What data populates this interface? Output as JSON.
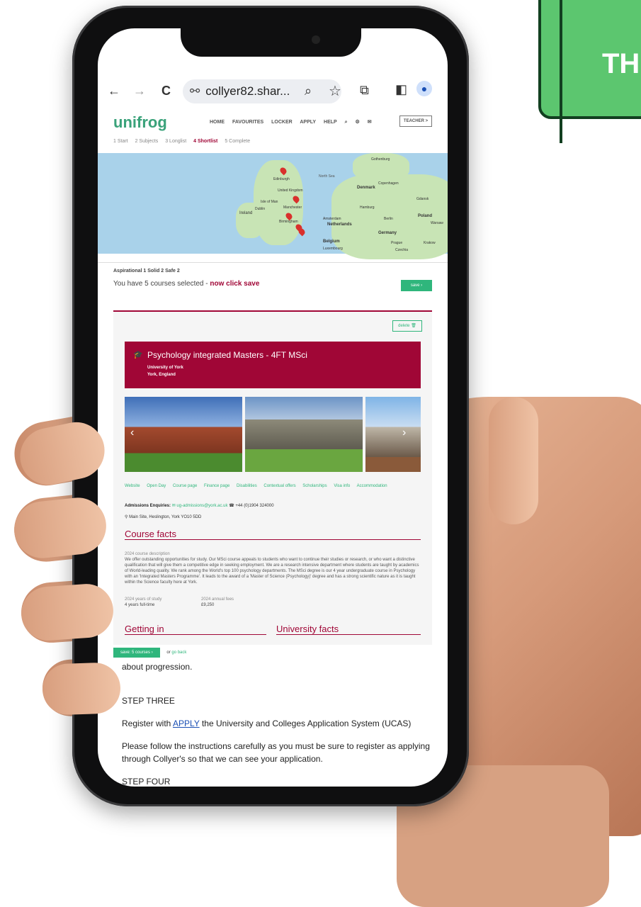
{
  "banner": {
    "text": "TH"
  },
  "browser": {
    "url": "collyer82.shar...",
    "back_icon": "←",
    "forward_icon": "→",
    "reload_icon": "C"
  },
  "site": {
    "logo": "unifrog",
    "nav": [
      "HOME",
      "FAVOURITES",
      "LOCKER",
      "APPLY",
      "HELP"
    ],
    "teacher_label": "TEACHER >",
    "steps": [
      "1 Start",
      "2 Subjects",
      "3 Longlist",
      "4 Shortlist",
      "5 Complete"
    ]
  },
  "map_labels": [
    "Edinburgh",
    "United Kingdom",
    "Isle of Man",
    "Manchester",
    "Ireland",
    "Dublin",
    "Birmingham",
    "Denmark",
    "Hamburg",
    "Amsterdam",
    "Netherlands",
    "Belgium",
    "Germany",
    "Poland",
    "Berlin",
    "Luxembourg",
    "Prague",
    "Czechia",
    "North Sea",
    "Gothenburg",
    "Copenhagen",
    "Gdansk",
    "Warsaw",
    "Krakow"
  ],
  "selection": {
    "categories": "Aspirational 1   Solid 2   Safe 2",
    "message": "You have 5 courses selected - ",
    "cta": "now click save",
    "save": "save ›"
  },
  "course": {
    "delete": "delete",
    "title": "Psychology integrated Masters - 4FT MSci",
    "university": "University of York",
    "location": "York, England",
    "links": [
      "Website",
      "Open Day",
      "Course page",
      "Finance page",
      "Disabilities",
      "Contextual offers",
      "Scholarships",
      "Visa info",
      "Accommodation"
    ],
    "admissions_label": "Admissions Enquiries:",
    "admissions_email": "ug-admissions@york.ac.uk",
    "admissions_phone": "+44 (0)1904 324000",
    "address": "Main Site, Heslington, York YO10 5DD",
    "facts_title": "Course facts",
    "desc_label": "2024 course description",
    "description": "We offer outstanding opportunities for study. Our MSci course appeals to students who want to continue their studies or research, or who want a distinctive qualification that will give them a competitive edge in seeking employment. We are a research intensive department where students are taught by academics of World-leading quality. We rank among the World's top 100 psychology departments. The MSci degree is our 4 year undergraduate course in Psychology with an 'Integrated Masters Programme'. It leads to the award of a 'Master of Science (Psychology)' degree and has a strong scientific nature as it is taught within the Science faculty here at York.",
    "years_label": "2024 years of study",
    "years_value": "4 years full-time",
    "fees_label": "2024 annual fees",
    "fees_value": "£9,250",
    "getting_in": "Getting in",
    "university_facts": "University facts"
  },
  "footer": {
    "save_courses": "save: 5 courses ›",
    "or_text": "or",
    "go_back": "go back"
  },
  "page": {
    "fragment": "about progression.",
    "step3_title": "STEP THREE",
    "step3_pre": "Register with ",
    "step3_link": "APPLY",
    "step3_post": " the University and Colleges Application System (UCAS)",
    "step3_body": "Please follow the instructions carefully as you must be sure to register as applying through Collyer's so that we can see your application.",
    "step4_title": "STEP FOUR"
  }
}
